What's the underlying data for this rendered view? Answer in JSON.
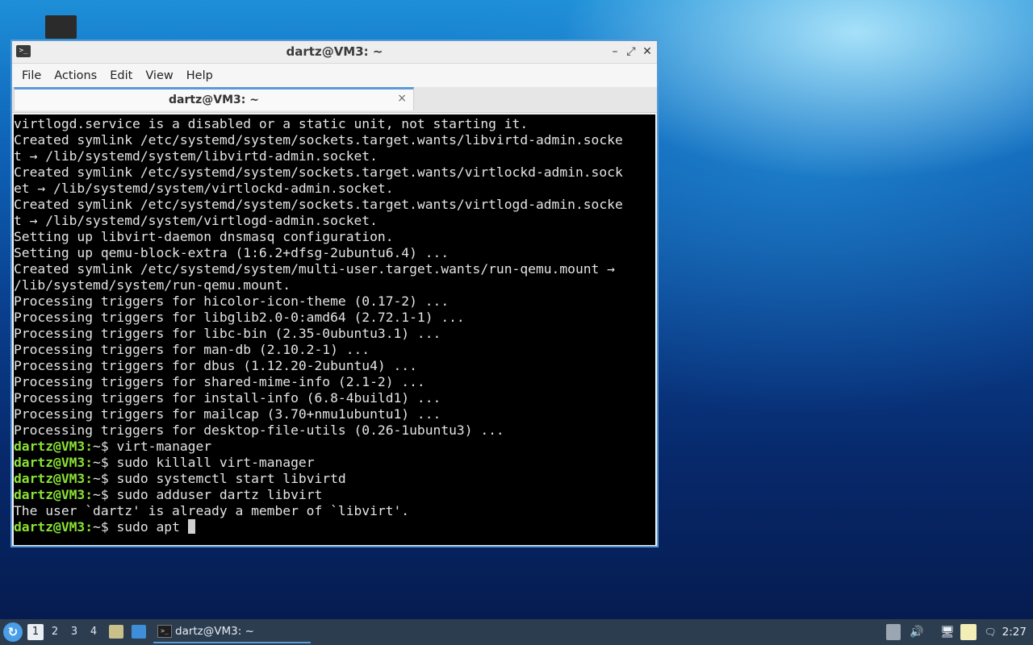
{
  "window": {
    "title": "dartz@VM3: ~",
    "buttons": {
      "minimize": "–",
      "maximize": "⤢",
      "close": "✕"
    }
  },
  "menu": [
    "File",
    "Actions",
    "Edit",
    "View",
    "Help"
  ],
  "tab": {
    "label": "dartz@VM3: ~",
    "close": "×"
  },
  "terminal": {
    "lines": [
      {
        "type": "out",
        "text": "virtlogd.service is a disabled or a static unit, not starting it."
      },
      {
        "type": "out",
        "text": "Created symlink /etc/systemd/system/sockets.target.wants/libvirtd-admin.socke"
      },
      {
        "type": "out",
        "text": "t → /lib/systemd/system/libvirtd-admin.socket."
      },
      {
        "type": "out",
        "text": "Created symlink /etc/systemd/system/sockets.target.wants/virtlockd-admin.sock"
      },
      {
        "type": "out",
        "text": "et → /lib/systemd/system/virtlockd-admin.socket."
      },
      {
        "type": "out",
        "text": "Created symlink /etc/systemd/system/sockets.target.wants/virtlogd-admin.socke"
      },
      {
        "type": "out",
        "text": "t → /lib/systemd/system/virtlogd-admin.socket."
      },
      {
        "type": "out",
        "text": "Setting up libvirt-daemon dnsmasq configuration."
      },
      {
        "type": "out",
        "text": "Setting up qemu-block-extra (1:6.2+dfsg-2ubuntu6.4) ..."
      },
      {
        "type": "out",
        "text": "Created symlink /etc/systemd/system/multi-user.target.wants/run-qemu.mount →"
      },
      {
        "type": "out",
        "text": "/lib/systemd/system/run-qemu.mount."
      },
      {
        "type": "out",
        "text": "Processing triggers for hicolor-icon-theme (0.17-2) ..."
      },
      {
        "type": "out",
        "text": "Processing triggers for libglib2.0-0:amd64 (2.72.1-1) ..."
      },
      {
        "type": "out",
        "text": "Processing triggers for libc-bin (2.35-0ubuntu3.1) ..."
      },
      {
        "type": "out",
        "text": "Processing triggers for man-db (2.10.2-1) ..."
      },
      {
        "type": "out",
        "text": "Processing triggers for dbus (1.12.20-2ubuntu4) ..."
      },
      {
        "type": "out",
        "text": "Processing triggers for shared-mime-info (2.1-2) ..."
      },
      {
        "type": "out",
        "text": "Processing triggers for install-info (6.8-4build1) ..."
      },
      {
        "type": "out",
        "text": "Processing triggers for mailcap (3.70+nmu1ubuntu1) ..."
      },
      {
        "type": "out",
        "text": "Processing triggers for desktop-file-utils (0.26-1ubuntu3) ..."
      },
      {
        "type": "cmd",
        "prompt": "dartz@VM3:",
        "path": "~",
        "sign": "$ ",
        "text": "virt-manager"
      },
      {
        "type": "cmd",
        "prompt": "dartz@VM3:",
        "path": "~",
        "sign": "$ ",
        "text": "sudo killall virt-manager"
      },
      {
        "type": "cmd",
        "prompt": "dartz@VM3:",
        "path": "~",
        "sign": "$ ",
        "text": "sudo systemctl start libvirtd"
      },
      {
        "type": "cmd",
        "prompt": "dartz@VM3:",
        "path": "~",
        "sign": "$ ",
        "text": "sudo adduser dartz libvirt"
      },
      {
        "type": "out",
        "text": "The user `dartz' is already a member of `libvirt'."
      },
      {
        "type": "cmd",
        "prompt": "dartz@VM3:",
        "path": "~",
        "sign": "$ ",
        "text": "sudo apt ",
        "cursor": true
      }
    ]
  },
  "taskbar": {
    "workspaces": [
      "1",
      "2",
      "3",
      "4"
    ],
    "active_workspace": "1",
    "task_label": "dartz@VM3: ~",
    "clock": "2:27"
  },
  "colors": {
    "prompt": "#8ae234",
    "accent": "#5a9ad6",
    "taskbar": "#2c3d50"
  }
}
